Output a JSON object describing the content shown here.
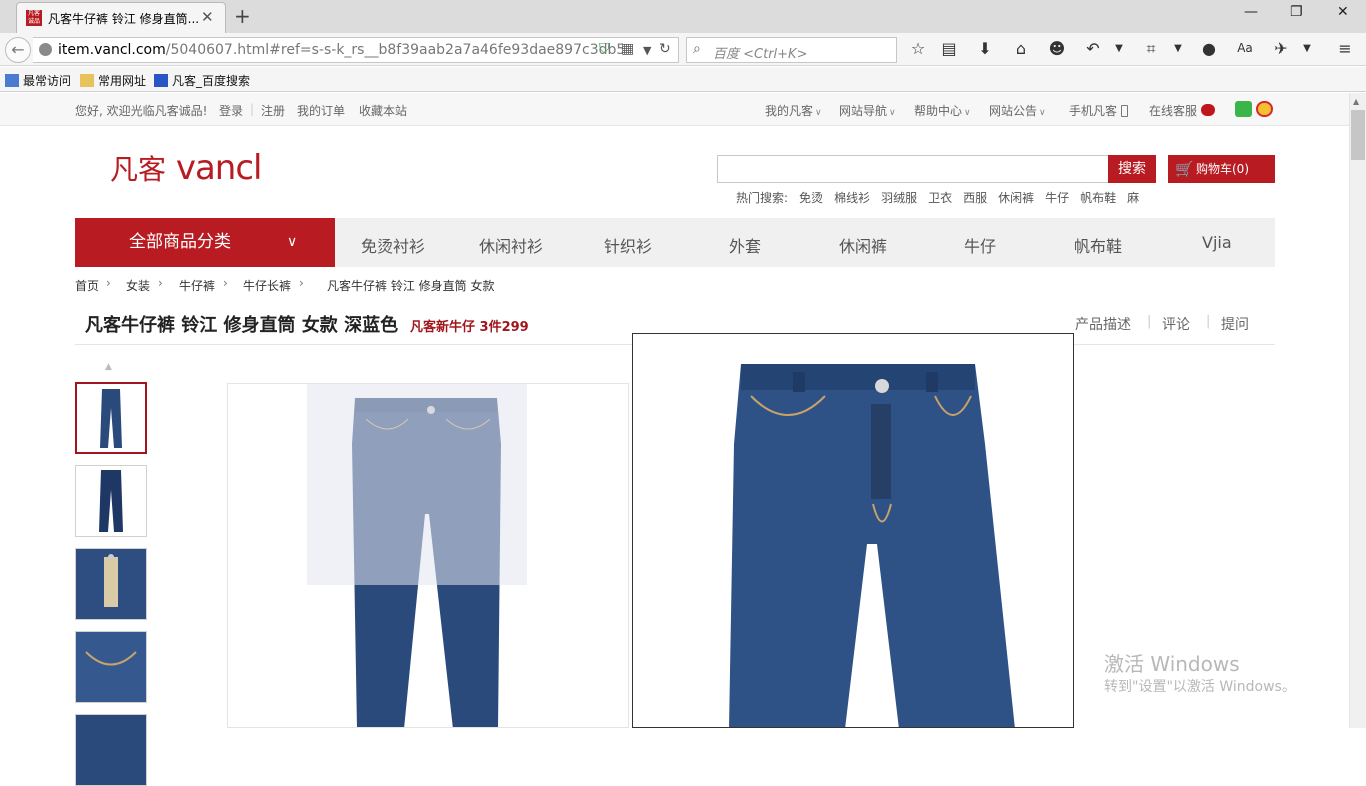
{
  "browser": {
    "tab_title": "凡客牛仔裤 铃江 修身直筒...",
    "tab_favicon_text": "凡客诚品",
    "url_host": "item.vancl.com",
    "url_path": "/5040607.html#ref=s-s-k_rs__b8f39aab2a7a46fe93dae897c3db51f",
    "search_placeholder": "百度 <Ctrl+K>",
    "bookmarks": [
      "最常访问",
      "常用网址",
      "凡客_百度搜索"
    ]
  },
  "site_top": {
    "welcome": "您好, 欢迎光临凡客诚品!",
    "login": "登录",
    "register": "注册",
    "my_orders": "我的订单",
    "bookmark_site": "收藏本站",
    "my_vancl": "我的凡客",
    "site_nav": "网站导航",
    "help_center": "帮助中心",
    "announcements": "网站公告",
    "mobile": "手机凡客",
    "online_service": "在线客服"
  },
  "header": {
    "logo_cn": "凡客",
    "logo_en": "vancl",
    "search_button": "搜索",
    "cart_label": "购物车(0)",
    "hot_search_label": "热门搜索:",
    "hot_searches": [
      "免烫",
      "棉线衫",
      "羽绒服",
      "卫衣",
      "西服",
      "休闲裤",
      "牛仔",
      "帆布鞋",
      "麻"
    ]
  },
  "nav": {
    "all_categories": "全部商品分类",
    "items": [
      "免烫衬衫",
      "休闲衬衫",
      "针织衫",
      "外套",
      "休闲裤",
      "牛仔",
      "帆布鞋",
      "Vjia"
    ]
  },
  "breadcrumb": [
    "首页",
    "女装",
    "牛仔裤",
    "牛仔长裤",
    "凡客牛仔裤 铃江 修身直筒 女款"
  ],
  "product": {
    "title": "凡客牛仔裤 铃江 修身直筒 女款 深蓝色",
    "promo": "凡客新牛仔 3件299",
    "tabs": [
      "产品描述",
      "评论",
      "提问"
    ]
  },
  "watermark": {
    "line1": "激活 Windows",
    "line2": "转到\"设置\"以激活 Windows。"
  },
  "colors": {
    "brand_red": "#b81c22",
    "promo_red": "#a0161c",
    "denim_dark": "#24406e",
    "denim_mid": "#3b5f92"
  }
}
